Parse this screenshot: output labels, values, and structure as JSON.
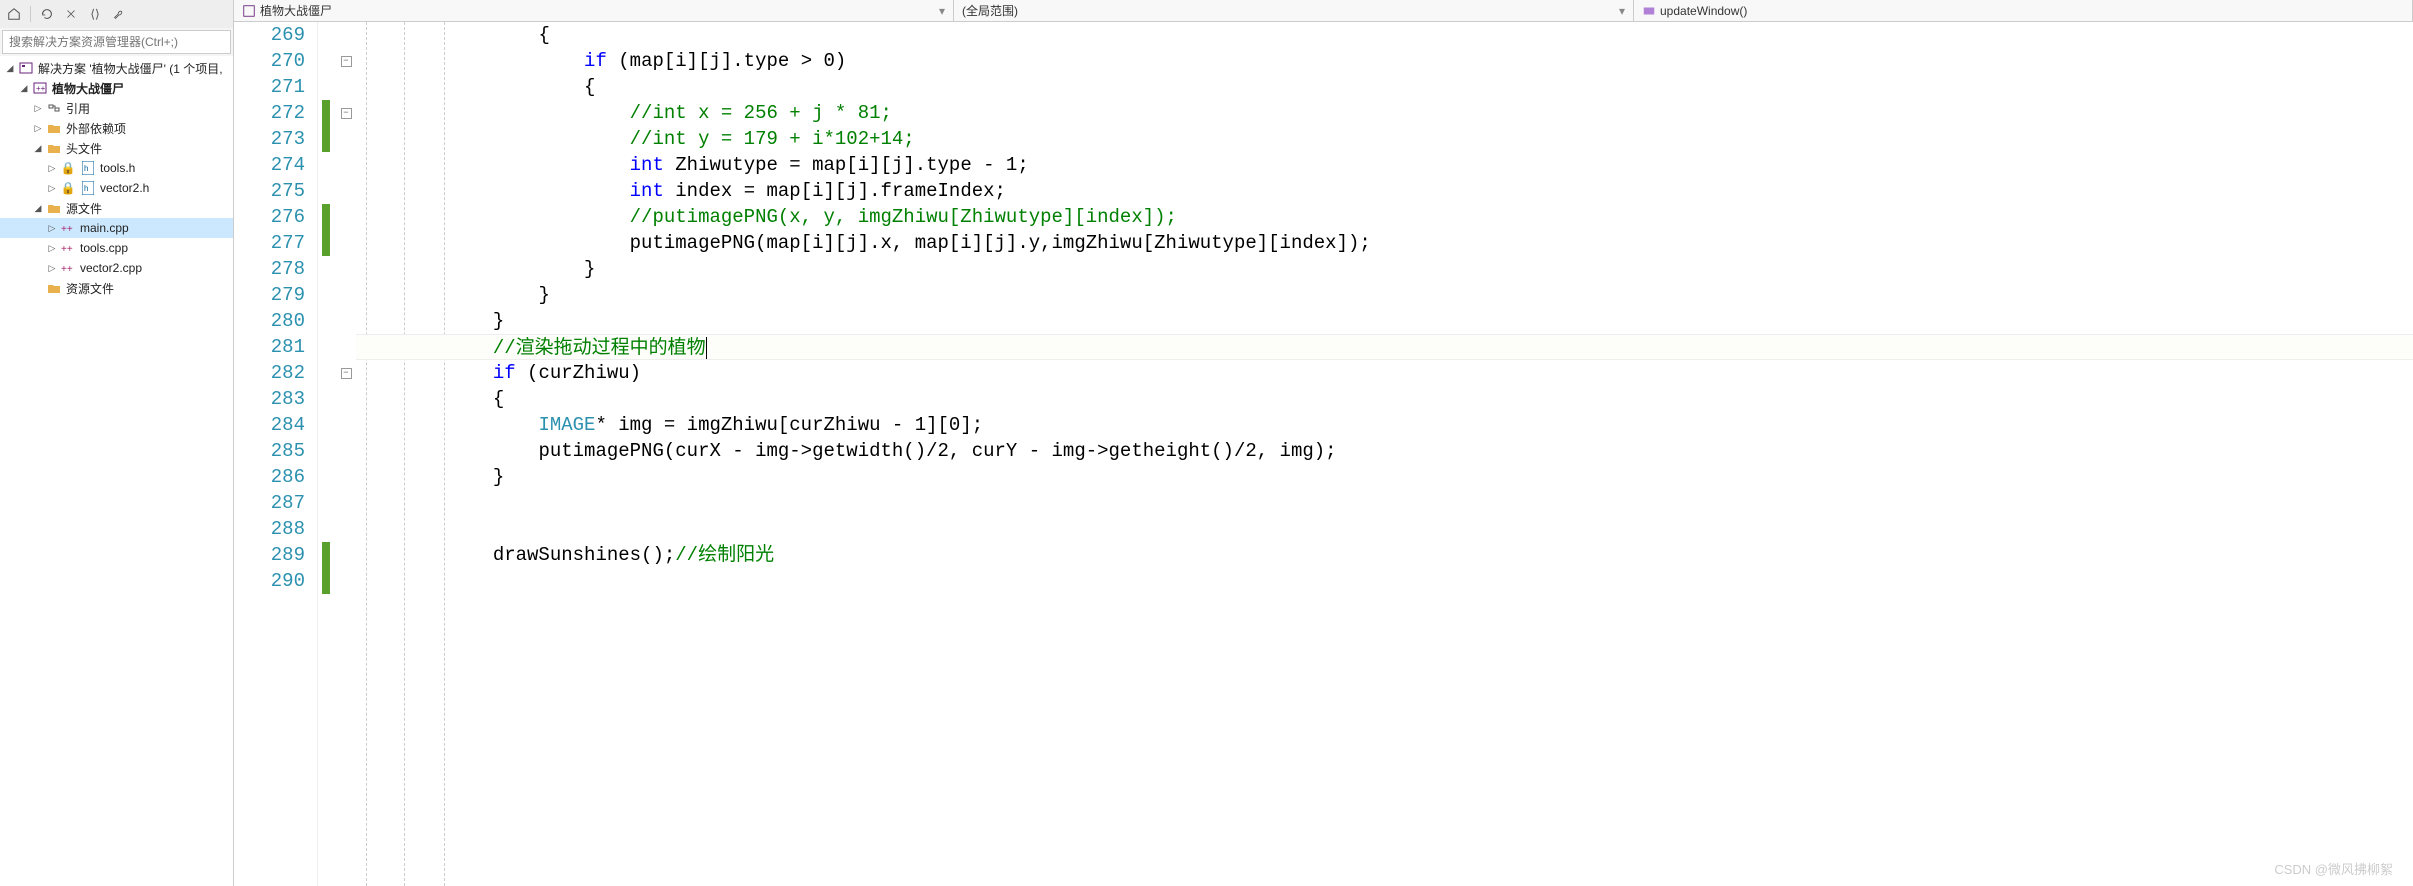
{
  "toolbar": {
    "search_placeholder": "搜索解决方案资源管理器(Ctrl+;)"
  },
  "tree": {
    "solution": "解决方案 '植物大战僵尸' (1 个项目,",
    "project": "植物大战僵尸",
    "refs": "引用",
    "external": "外部依赖项",
    "headers": "头文件",
    "header_files": [
      "tools.h",
      "vector2.h"
    ],
    "sources": "源文件",
    "source_files": [
      "main.cpp",
      "tools.cpp",
      "vector2.cpp"
    ],
    "resources": "资源文件"
  },
  "dropdowns": {
    "file": "植物大战僵尸",
    "scope": "(全局范围)",
    "func": "updateWindow()"
  },
  "code": {
    "lines": [
      {
        "n": 269,
        "indent": 4,
        "tokens": [
          {
            "t": "n",
            "v": "{"
          }
        ]
      },
      {
        "n": 270,
        "indent": 5,
        "fold": true,
        "tokens": [
          {
            "t": "k",
            "v": "if"
          },
          {
            "t": "n",
            "v": " (map[i][j].type > 0)"
          }
        ]
      },
      {
        "n": 271,
        "indent": 5,
        "tokens": [
          {
            "t": "n",
            "v": "{"
          }
        ]
      },
      {
        "n": 272,
        "indent": 6,
        "mark": true,
        "fold": true,
        "tokens": [
          {
            "t": "c",
            "v": "//int x = 256 + j * 81;"
          }
        ]
      },
      {
        "n": 273,
        "indent": 6,
        "mark": true,
        "tokens": [
          {
            "t": "c",
            "v": "//int y = 179 + i*102+14;"
          }
        ]
      },
      {
        "n": 274,
        "indent": 6,
        "tokens": [
          {
            "t": "k",
            "v": "int"
          },
          {
            "t": "n",
            "v": " Zhiwutype = map[i][j].type - 1;"
          }
        ]
      },
      {
        "n": 275,
        "indent": 6,
        "tokens": [
          {
            "t": "k",
            "v": "int"
          },
          {
            "t": "n",
            "v": " index = map[i][j].frameIndex;"
          }
        ]
      },
      {
        "n": 276,
        "indent": 6,
        "mark": true,
        "tokens": [
          {
            "t": "c",
            "v": "//putimagePNG(x, y, imgZhiwu[Zhiwutype][index]);"
          }
        ]
      },
      {
        "n": 277,
        "indent": 6,
        "mark": true,
        "tokens": [
          {
            "t": "n",
            "v": "putimagePNG(map[i][j].x, map[i][j].y,imgZhiwu[Zhiwutype][index]);"
          }
        ]
      },
      {
        "n": 278,
        "indent": 5,
        "tokens": [
          {
            "t": "n",
            "v": "}"
          }
        ]
      },
      {
        "n": 279,
        "indent": 4,
        "tokens": [
          {
            "t": "n",
            "v": "}"
          }
        ]
      },
      {
        "n": 280,
        "indent": 3,
        "tokens": [
          {
            "t": "n",
            "v": "}"
          }
        ]
      },
      {
        "n": 281,
        "indent": 3,
        "hl": true,
        "tokens": [
          {
            "t": "c",
            "v": "//渲染拖动过程中的植物"
          }
        ],
        "cursor": true
      },
      {
        "n": 282,
        "indent": 3,
        "fold": true,
        "tokens": [
          {
            "t": "k",
            "v": "if"
          },
          {
            "t": "n",
            "v": " (curZhiwu)"
          }
        ]
      },
      {
        "n": 283,
        "indent": 3,
        "tokens": [
          {
            "t": "n",
            "v": "{"
          }
        ]
      },
      {
        "n": 284,
        "indent": 4,
        "tokens": [
          {
            "t": "t",
            "v": "IMAGE"
          },
          {
            "t": "n",
            "v": "* img = imgZhiwu[curZhiwu - 1][0];"
          }
        ]
      },
      {
        "n": 285,
        "indent": 4,
        "tokens": [
          {
            "t": "n",
            "v": "putimagePNG(curX - img->getwidth()/2, curY - img->getheight()/2, img);"
          }
        ]
      },
      {
        "n": 286,
        "indent": 3,
        "tokens": [
          {
            "t": "n",
            "v": "}"
          }
        ]
      },
      {
        "n": 287,
        "indent": 0,
        "tokens": []
      },
      {
        "n": 288,
        "indent": 0,
        "tokens": []
      },
      {
        "n": 289,
        "indent": 3,
        "mark": true,
        "tokens": [
          {
            "t": "n",
            "v": "drawSunshines();"
          },
          {
            "t": "c",
            "v": "//绘制阳光"
          }
        ]
      },
      {
        "n": 290,
        "indent": 0,
        "mark": true,
        "tokens": []
      }
    ]
  },
  "watermark": "CSDN @微风拂柳絮"
}
